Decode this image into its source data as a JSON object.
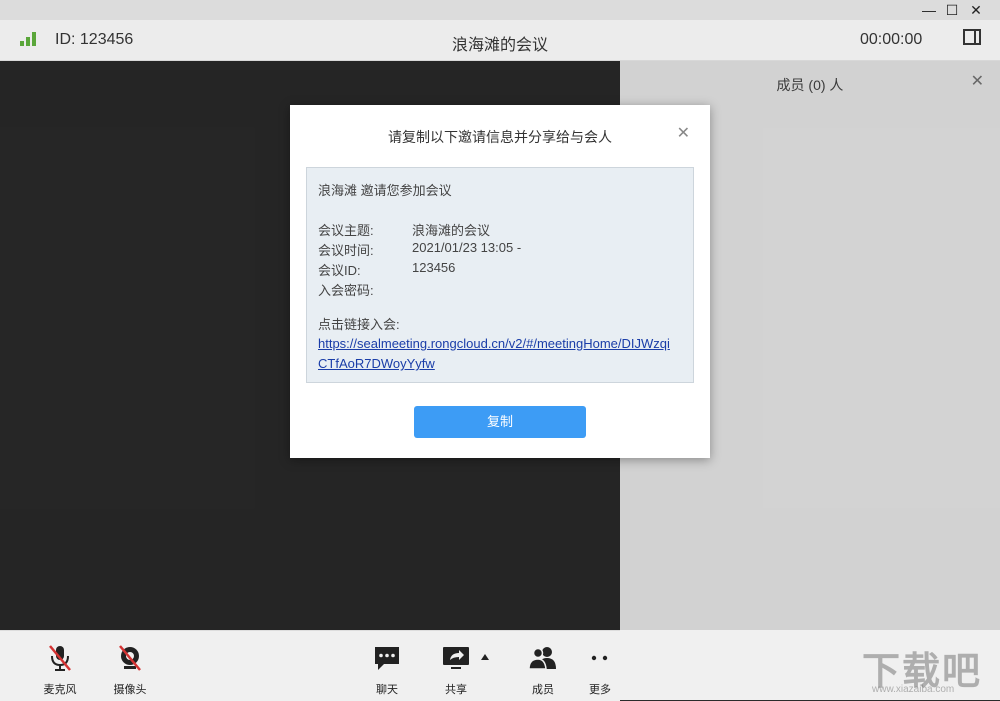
{
  "window": {
    "minimize_glyph": "—",
    "maximize_glyph": "☐",
    "close_glyph": "✕"
  },
  "header": {
    "meeting_id": "ID: 123456",
    "meeting_title": "浪海滩的会议",
    "timer": "00:00:00",
    "signal_icon": "signal-bars-icon",
    "panel_icon": "sidebar-toggle-icon"
  },
  "members_panel": {
    "title": "成员 (0) 人",
    "close_glyph": "✕"
  },
  "dialog": {
    "title": "请复制以下邀请信息并分享给与会人",
    "close_glyph": "✕",
    "invite_header": "浪海滩 邀请您参加会议",
    "fields": [
      {
        "label": "会议主题:",
        "value": "浪海滩的会议"
      },
      {
        "label": "会议时间:",
        "value": "2021/01/23 13:05 -"
      },
      {
        "label": "会议ID:",
        "value": "123456"
      },
      {
        "label": "入会密码:",
        "value": ""
      }
    ],
    "link_label": "点击链接入会:",
    "link_url": "https://sealmeeting.rongcloud.cn/v2/#/meetingHome/DIJWzqiCTfAoR7DWoyYyfw",
    "copy_label": "复制"
  },
  "toolbar": {
    "mic_label": "麦克风",
    "camera_label": "摄像头",
    "chat_label": "聊天",
    "share_label": "共享",
    "members_label": "成员",
    "more_label": "更多"
  },
  "watermark": {
    "text": "下载吧",
    "sub": "www.xiazaiba.com"
  },
  "colors": {
    "accent": "#3d9cf5",
    "signal": "#5aa63a",
    "mic_muted": "#d33333"
  }
}
